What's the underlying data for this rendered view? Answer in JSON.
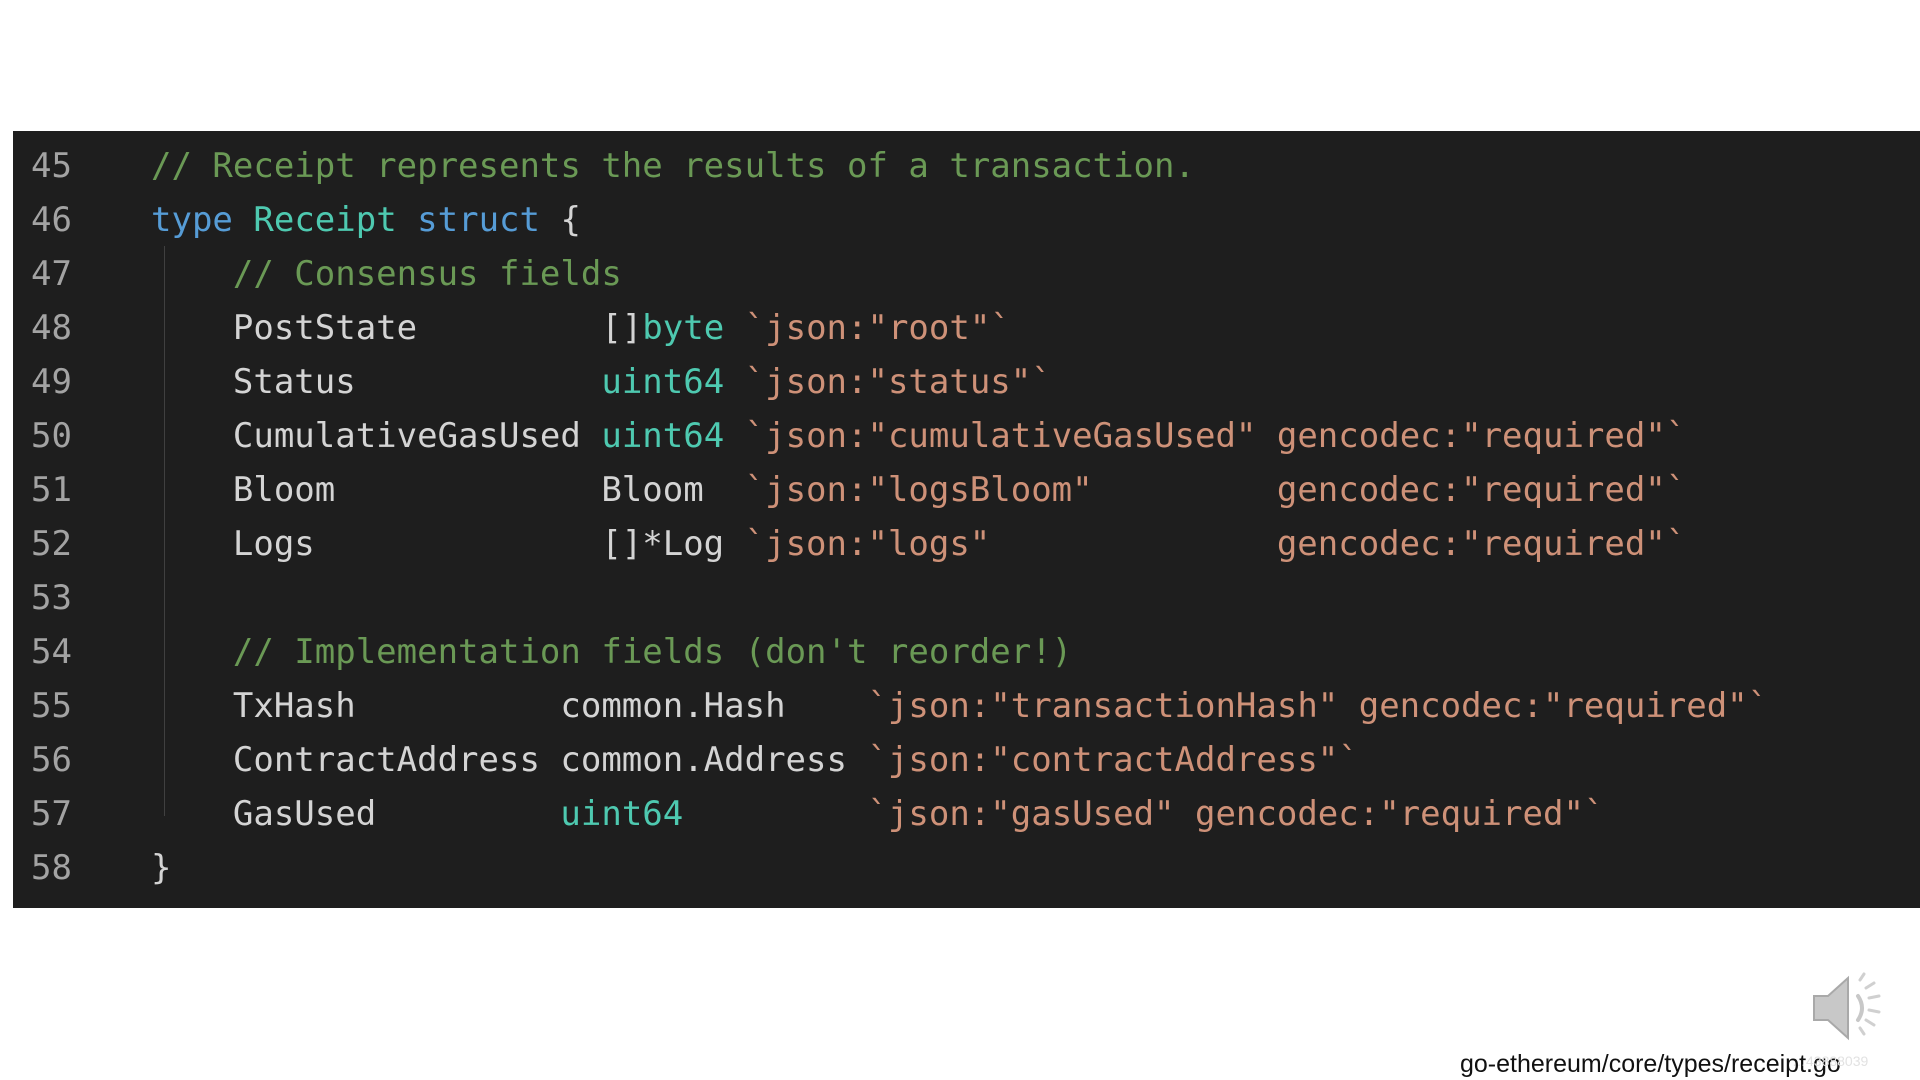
{
  "code": {
    "lines": [
      {
        "number": "45",
        "tokens": [
          {
            "text": "// Receipt represents the results of a transaction.",
            "kind": "comment"
          }
        ]
      },
      {
        "number": "46",
        "tokens": [
          {
            "text": "type",
            "kind": "keyword"
          },
          {
            "text": " ",
            "kind": "plain"
          },
          {
            "text": "Receipt",
            "kind": "type"
          },
          {
            "text": " ",
            "kind": "plain"
          },
          {
            "text": "struct",
            "kind": "keyword"
          },
          {
            "text": " {",
            "kind": "plain"
          }
        ]
      },
      {
        "number": "47",
        "tokens": [
          {
            "text": "    ",
            "kind": "plain"
          },
          {
            "text": "// Consensus fields",
            "kind": "comment"
          }
        ]
      },
      {
        "number": "48",
        "tokens": [
          {
            "text": "    PostState         []",
            "kind": "plain"
          },
          {
            "text": "byte",
            "kind": "type"
          },
          {
            "text": " ",
            "kind": "plain"
          },
          {
            "text": "`json:\"root\"`",
            "kind": "tag"
          }
        ]
      },
      {
        "number": "49",
        "tokens": [
          {
            "text": "    Status            ",
            "kind": "plain"
          },
          {
            "text": "uint64",
            "kind": "type"
          },
          {
            "text": " ",
            "kind": "plain"
          },
          {
            "text": "`json:\"status\"`",
            "kind": "tag"
          }
        ]
      },
      {
        "number": "50",
        "tokens": [
          {
            "text": "    CumulativeGasUsed ",
            "kind": "plain"
          },
          {
            "text": "uint64",
            "kind": "type"
          },
          {
            "text": " ",
            "kind": "plain"
          },
          {
            "text": "`json:\"cumulativeGasUsed\" gencodec:\"required\"`",
            "kind": "tag"
          }
        ]
      },
      {
        "number": "51",
        "tokens": [
          {
            "text": "    Bloom             Bloom  ",
            "kind": "plain"
          },
          {
            "text": "`json:\"logsBloom\"         gencodec:\"required\"`",
            "kind": "tag"
          }
        ]
      },
      {
        "number": "52",
        "tokens": [
          {
            "text": "    Logs              []*Log ",
            "kind": "plain"
          },
          {
            "text": "`json:\"logs\"              gencodec:\"required\"`",
            "kind": "tag"
          }
        ]
      },
      {
        "number": "53",
        "tokens": []
      },
      {
        "number": "54",
        "tokens": [
          {
            "text": "    ",
            "kind": "plain"
          },
          {
            "text": "// Implementation fields (don't reorder!)",
            "kind": "comment"
          }
        ]
      },
      {
        "number": "55",
        "tokens": [
          {
            "text": "    TxHash          common.Hash    ",
            "kind": "plain"
          },
          {
            "text": "`json:\"transactionHash\" gencodec:\"required\"`",
            "kind": "tag"
          }
        ]
      },
      {
        "number": "56",
        "tokens": [
          {
            "text": "    ContractAddress common.Address ",
            "kind": "plain"
          },
          {
            "text": "`json:\"contractAddress\"`",
            "kind": "tag"
          }
        ]
      },
      {
        "number": "57",
        "tokens": [
          {
            "text": "    GasUsed         ",
            "kind": "plain"
          },
          {
            "text": "uint64",
            "kind": "type"
          },
          {
            "text": "         ",
            "kind": "plain"
          },
          {
            "text": "`json:\"gasUsed\" gencodec:\"required\"`",
            "kind": "tag"
          }
        ]
      },
      {
        "number": "58",
        "tokens": [
          {
            "text": "}",
            "kind": "plain"
          }
        ]
      }
    ]
  },
  "caption": {
    "source_path": "go-ethereum/core/types/receipt.go",
    "watermark": "…43888039"
  },
  "icons": {
    "speaker": "speaker-volume-icon"
  },
  "colors": {
    "editor_background": "#1e1e1e",
    "line_number": "#a3a3a3",
    "comment": "#6a9955",
    "keyword": "#569cd6",
    "type": "#4ec9b0",
    "plain": "#d4d4d4",
    "struct_tag": "#ce9178"
  }
}
